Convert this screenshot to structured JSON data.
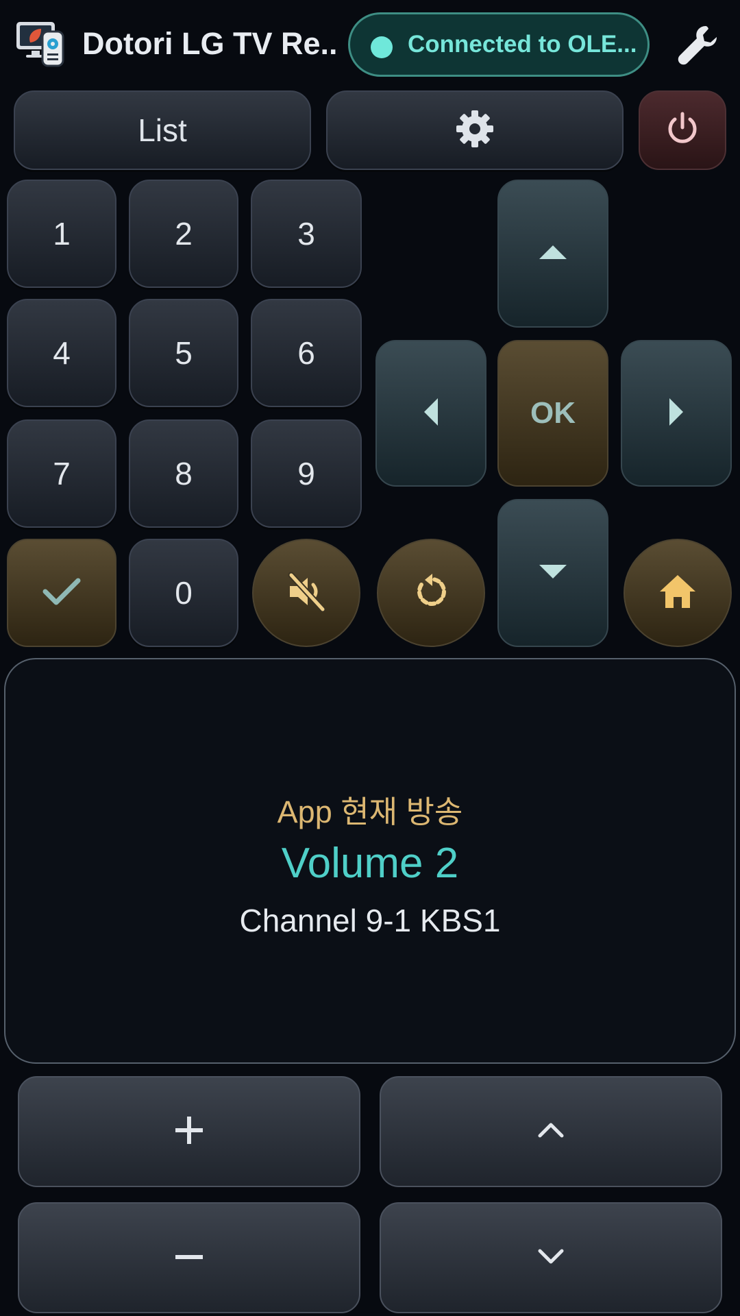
{
  "header": {
    "title": "Dotori LG TV Re...",
    "status": "Connected to OLE...",
    "icons": {
      "app": "tv-remote-app-icon",
      "settings": "wrench-icon"
    },
    "colors": {
      "status_text": "#77e6da",
      "status_dot": "#6fe8da"
    }
  },
  "toolbar": {
    "list_label": "List",
    "settings_icon": "gear-icon",
    "power_icon": "power-icon"
  },
  "keypad": {
    "k1": "1",
    "k2": "2",
    "k3": "3",
    "k4": "4",
    "k5": "5",
    "k6": "6",
    "k7": "7",
    "k8": "8",
    "k9": "9",
    "k0": "0",
    "confirm_icon": "check-icon",
    "mute_icon": "mute-icon",
    "back_icon": "replay-icon",
    "home_icon": "home-icon"
  },
  "dpad": {
    "ok_label": "OK",
    "up_icon": "triangle-up-icon",
    "down_icon": "triangle-down-icon",
    "left_icon": "triangle-left-icon",
    "right_icon": "triangle-right-icon"
  },
  "info": {
    "app": "App 현재 방송",
    "volume": "Volume 2",
    "channel": "Channel 9-1 KBS1"
  },
  "controls": {
    "volume_up_icon": "plus-icon",
    "volume_down_icon": "minus-icon",
    "channel_up_icon": "chevron-up-icon",
    "channel_down_icon": "chevron-down-icon"
  }
}
